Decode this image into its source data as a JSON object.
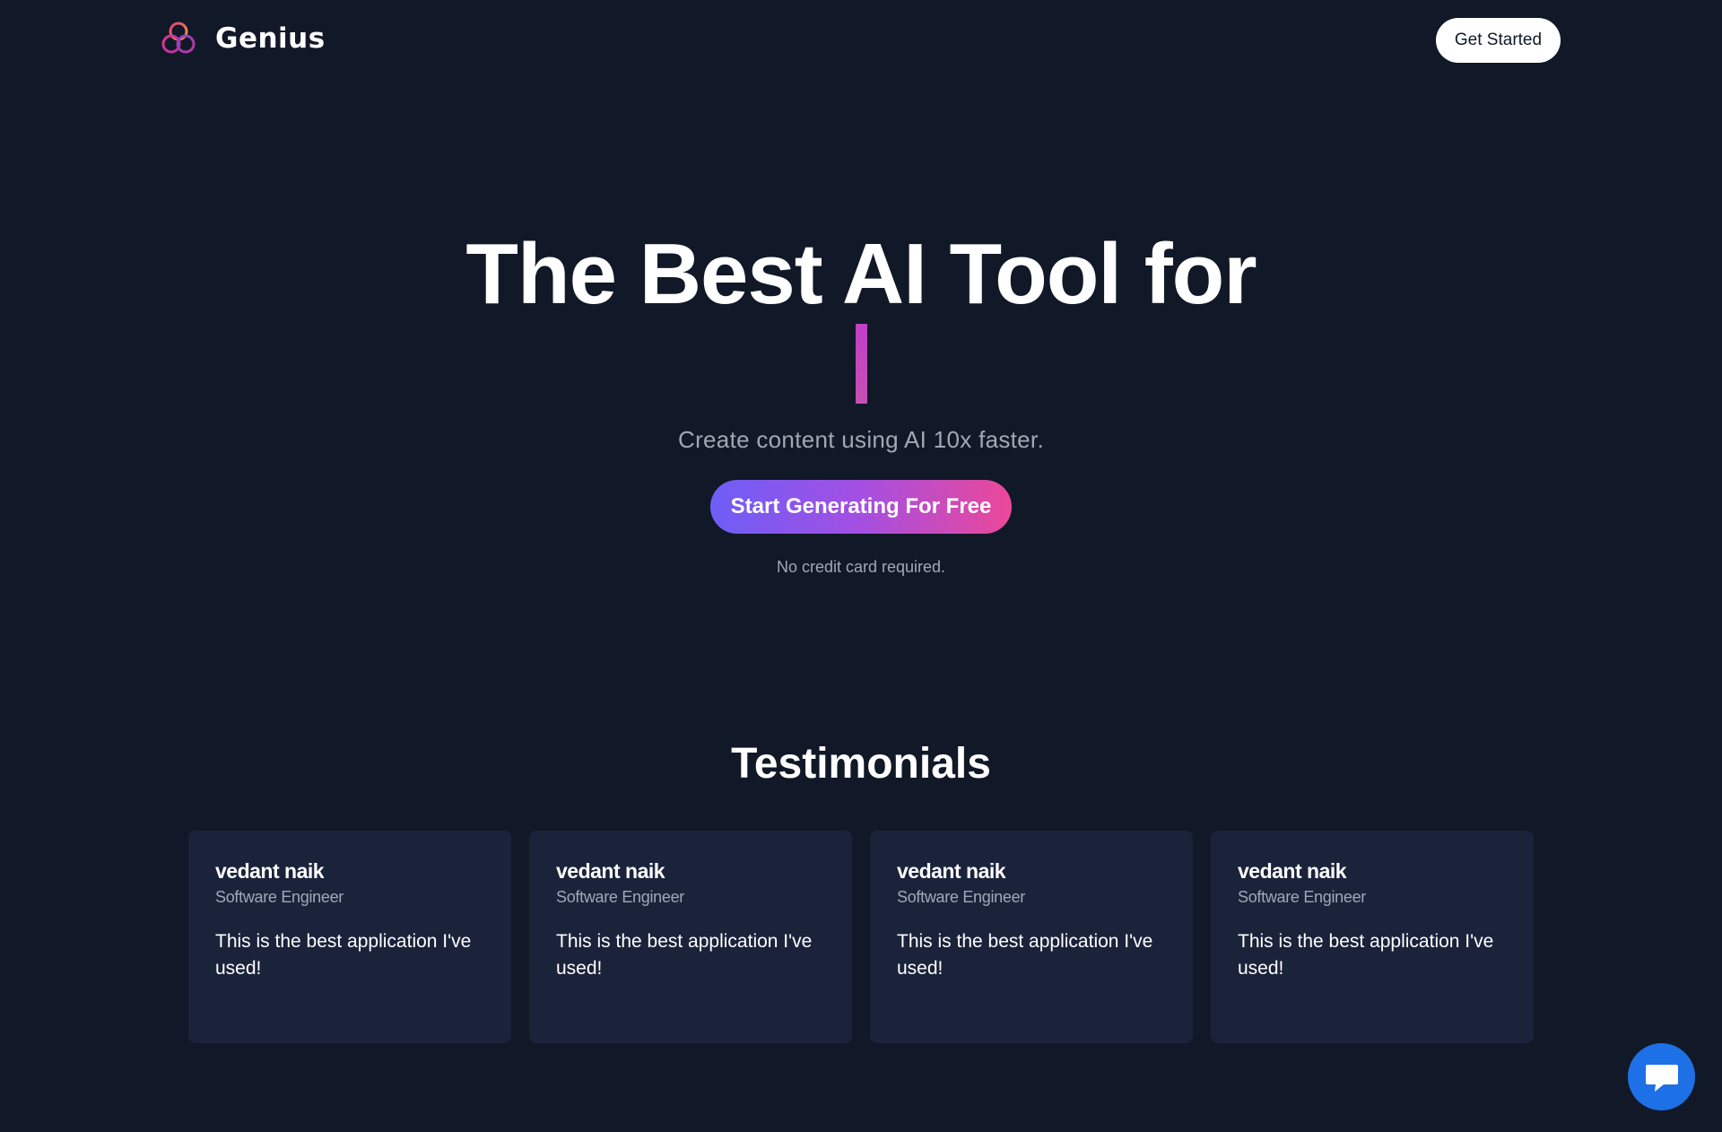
{
  "navbar": {
    "brand_name": "Genius",
    "logo_icon": "three-rings-logo-icon",
    "get_started_label": "Get Started"
  },
  "hero": {
    "title": "The Best AI Tool for",
    "subtitle": "Create content using AI 10x faster.",
    "cta_label": "Start Generating For Free",
    "note": "No credit card required."
  },
  "testimonials": {
    "heading": "Testimonials",
    "items": [
      {
        "name": "vedant naik",
        "role": "Software Engineer",
        "text": "This is the best application I've used!"
      },
      {
        "name": "vedant naik",
        "role": "Software Engineer",
        "text": "This is the best application I've used!"
      },
      {
        "name": "vedant naik",
        "role": "Software Engineer",
        "text": "This is the best application I've used!"
      },
      {
        "name": "vedant naik",
        "role": "Software Engineer",
        "text": "This is the best application I've used!"
      }
    ]
  },
  "chat_widget": {
    "icon": "chat-bubble-icon"
  },
  "colors": {
    "background": "#111827",
    "card_background": "#1b233b",
    "muted_text": "#a1a8b4",
    "cta_gradient_start": "#6d5ef6",
    "cta_gradient_end": "#ec4899",
    "typing_cursor": "#c13fc6",
    "chat_button": "#1d70e6"
  }
}
